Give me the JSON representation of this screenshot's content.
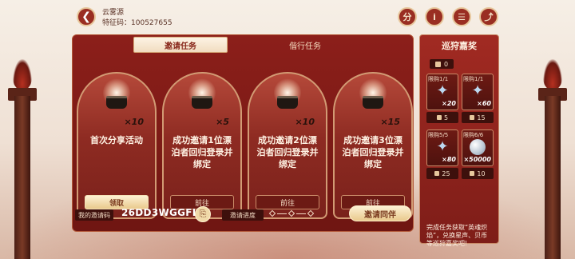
{
  "header": {
    "back_glyph": "❮",
    "player_name": "云雾源",
    "code_label": "特征码：",
    "code_value": "100527655",
    "icons": [
      {
        "name": "share-code-icon",
        "glyph": "分"
      },
      {
        "name": "info-icon",
        "glyph": "i"
      },
      {
        "name": "notes-icon",
        "glyph": "☰"
      },
      {
        "name": "share-icon",
        "glyph": "⤴"
      }
    ]
  },
  "tabs": [
    {
      "label": "邀请任务",
      "active": true
    },
    {
      "label": "偕行任务",
      "active": false
    }
  ],
  "tasks": [
    {
      "count": "×10",
      "title": "首次分享活动",
      "button": "领取",
      "claimable": true
    },
    {
      "count": "×5",
      "title": "成功邀请1位漂泊者回归登录并绑定",
      "button": "前往",
      "claimable": false
    },
    {
      "count": "×10",
      "title": "成功邀请2位漂泊者回归登录并绑定",
      "button": "前往",
      "claimable": false
    },
    {
      "count": "×15",
      "title": "成功邀请3位漂泊者回归登录并绑定",
      "button": "前往",
      "claimable": false
    }
  ],
  "bottom": {
    "my_code_label": "我的邀请码",
    "invite_code": "26DD3WGGFL",
    "copy_glyph": "⎘",
    "progress_label": "邀请进度",
    "invite_button": "邀请同伴"
  },
  "rewards": {
    "title": "巡狩嘉奖",
    "owned": "0",
    "items": [
      {
        "limit": "限购1/1",
        "icon": "star",
        "qty": "×20",
        "cost": "5"
      },
      {
        "limit": "限购1/1",
        "icon": "star",
        "qty": "×60",
        "cost": "15"
      },
      {
        "limit": "限购5/5",
        "icon": "star",
        "qty": "×80",
        "cost": "25"
      },
      {
        "limit": "限购6/6",
        "icon": "orb",
        "qty": "×50000",
        "cost": "10"
      }
    ],
    "description": "完成任务获取“英魂炽焰”，兑换星声、贝币等巡狩嘉奖吧!"
  },
  "colors": {
    "panel_red": "#8c1f1a",
    "accent_gold": "#e9c98c",
    "background": "#f6efe6"
  }
}
